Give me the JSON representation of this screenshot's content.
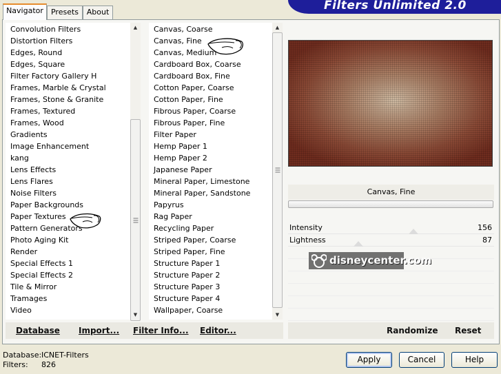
{
  "app": {
    "banner_title": "Filters Unlimited 2.0"
  },
  "tabs": [
    {
      "label": "Navigator",
      "active": true
    },
    {
      "label": "Presets",
      "active": false
    },
    {
      "label": "About",
      "active": false
    }
  ],
  "categories": {
    "items": [
      "Convolution Filters",
      "Distortion Filters",
      "Edges, Round",
      "Edges, Square",
      "Filter Factory Gallery H",
      "Frames, Marble & Crystal",
      "Frames, Stone & Granite",
      "Frames, Textured",
      "Frames, Wood",
      "Gradients",
      "Image Enhancement",
      "kang",
      "Lens Effects",
      "Lens Flares",
      "Noise Filters",
      "Paper Backgrounds",
      "Paper Textures",
      "Pattern Generators",
      "Photo Aging Kit",
      "Render",
      "Special Effects 1",
      "Special Effects 2",
      "Tile & Mirror",
      "Tramages",
      "Video"
    ],
    "selected": "Paper Textures"
  },
  "filters": {
    "items": [
      "Canvas, Coarse",
      "Canvas, Fine",
      "Canvas, Medium",
      "Cardboard Box, Coarse",
      "Cardboard Box, Fine",
      "Cotton Paper, Coarse",
      "Cotton Paper, Fine",
      "Fibrous Paper, Coarse",
      "Fibrous Paper, Fine",
      "Filter Paper",
      "Hemp Paper 1",
      "Hemp Paper 2",
      "Japanese Paper",
      "Mineral Paper, Limestone",
      "Mineral Paper, Sandstone",
      "Papyrus",
      "Rag Paper",
      "Recycling Paper",
      "Striped Paper, Coarse",
      "Striped Paper, Fine",
      "Structure Paper 1",
      "Structure Paper 2",
      "Structure Paper 3",
      "Structure Paper 4",
      "Wallpaper, Coarse"
    ],
    "selected": "Canvas, Fine"
  },
  "preview": {
    "filter_name": "Canvas, Fine"
  },
  "parameters": [
    {
      "label": "Intensity",
      "value": "156",
      "level": 0.61
    },
    {
      "label": "Lightness",
      "value": "87",
      "level": 0.34
    }
  ],
  "left_buttons": {
    "database": "Database",
    "import": "Import...",
    "filter_info": "Filter Info...",
    "editor": "Editor..."
  },
  "right_buttons": {
    "randomize": "Randomize",
    "reset": "Reset"
  },
  "status": {
    "database_label": "Database:",
    "database_value": "ICNET-Filters",
    "filters_label": "Filters:",
    "filters_value": "826"
  },
  "dialog_buttons": {
    "apply": "Apply",
    "cancel": "Cancel",
    "help": "Help"
  },
  "watermark": {
    "text": "disneycenter.com"
  },
  "icons": {
    "hand_cursor": "hand-pointer-icon",
    "scroll_up": "arrow-up-icon",
    "scroll_down": "arrow-down-icon"
  },
  "colors": {
    "banner": "#1e1e9a",
    "active_tab_accent": "#e68b2c",
    "preview_dark": "#6f2c1e",
    "preview_light": "#cdb9a1"
  }
}
